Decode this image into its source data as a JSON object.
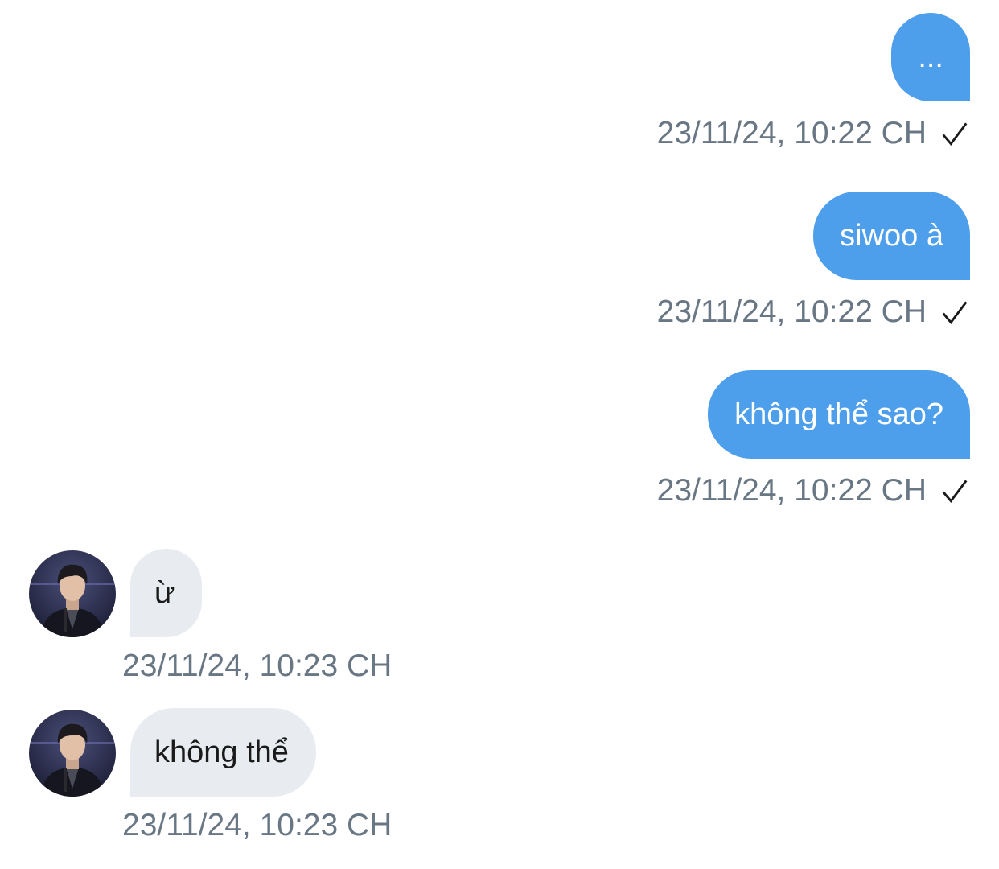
{
  "colors": {
    "sent_bubble": "#4d9eeb",
    "received_bubble": "#e8ecf1",
    "timestamp": "#697785"
  },
  "messages": [
    {
      "direction": "sent",
      "text": "...",
      "time": "23/11/24, 10:22 CH",
      "status_icon": "check-icon"
    },
    {
      "direction": "sent",
      "text": "siwoo à",
      "time": "23/11/24, 10:22 CH",
      "status_icon": "check-icon"
    },
    {
      "direction": "sent",
      "text": "không thể sao?",
      "time": "23/11/24, 10:22 CH",
      "status_icon": "check-icon"
    },
    {
      "direction": "received",
      "text": "ừ",
      "time": "23/11/24, 10:23 CH",
      "avatar_icon": "avatar-image"
    },
    {
      "direction": "received",
      "text": "không thể",
      "time": "23/11/24, 10:23 CH",
      "avatar_icon": "avatar-image"
    }
  ]
}
